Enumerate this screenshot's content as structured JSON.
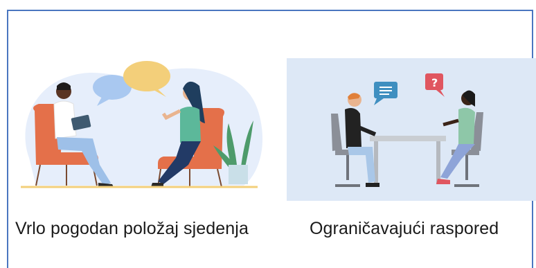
{
  "cards": [
    {
      "caption": "Vrlo pogodan položaj sjedenja",
      "illustration": "two-women-conversation-armchairs",
      "colors": {
        "bg": "#e8f0fb",
        "chair": "#e4704a",
        "bubble_blue": "#a9c8f0",
        "bubble_yellow": "#f3cf7a",
        "plant": "#4e9b6b"
      }
    },
    {
      "caption": "Ograničavajući raspored",
      "illustration": "interview-across-table",
      "colors": {
        "bg": "#dde8f6",
        "chair": "#8b8f98",
        "bubble_blue": "#3f8fc0",
        "bubble_red": "#e05660"
      }
    }
  ]
}
